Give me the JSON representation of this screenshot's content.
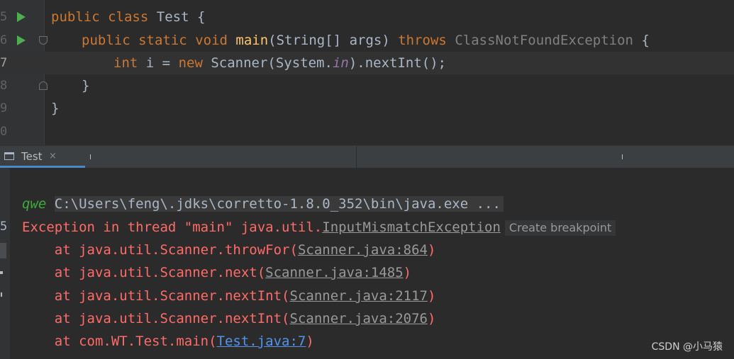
{
  "editor": {
    "lines": [
      {
        "num": "5",
        "tokens": [
          "public",
          "class",
          "Test",
          "{"
        ]
      },
      {
        "num": "6",
        "tokens": [
          "public",
          "static",
          "void",
          "main",
          "(String[] ",
          "args",
          ") ",
          "throws",
          "ClassNotFoundException",
          "{"
        ]
      },
      {
        "num": "7",
        "tokens": [
          "int",
          "i",
          " = ",
          "new",
          "Scanner(System.",
          "in",
          ").nextInt();"
        ]
      },
      {
        "num": "8",
        "tokens": [
          "}"
        ]
      },
      {
        "num": "9",
        "tokens": [
          "}"
        ]
      },
      {
        "num": "0",
        "tokens": []
      }
    ]
  },
  "run_panel": {
    "tab_label": "Test",
    "tab_close": "×"
  },
  "console": {
    "command": "C:\\Users\\feng\\.jdks\\corretto-1.8.0_352\\bin\\java.exe ...",
    "input_echo": "qwe",
    "exception_prefix": "Exception in thread \"main\" java.util.",
    "exception_class": "InputMismatchException",
    "breakpoint_badge": "Create breakpoint",
    "stack": [
      {
        "text": "    at java.util.Scanner.throwFor(",
        "link": "Scanner.java:864",
        "suffix": ")"
      },
      {
        "text": "    at java.util.Scanner.next(",
        "link": "Scanner.java:1485",
        "suffix": ")"
      },
      {
        "text": "    at java.util.Scanner.nextInt(",
        "link": "Scanner.java:2117",
        "suffix": ")"
      },
      {
        "text": "    at java.util.Scanner.nextInt(",
        "link": "Scanner.java:2076",
        "suffix": ")"
      },
      {
        "text": "    at com.WT.Test.main(",
        "link": "Test.java:7",
        "suffix": ")"
      }
    ],
    "gutter_digit": "5"
  },
  "watermark": "CSDN @小马猿",
  "colors": {
    "keyword": "#cc7832",
    "method": "#ffc66d",
    "error": "#ff6b68",
    "output": "#3cab3c",
    "link": "#5394ec"
  }
}
